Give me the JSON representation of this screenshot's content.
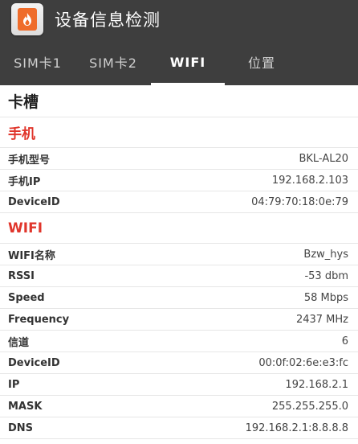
{
  "header": {
    "title": "设备信息检测",
    "icon": "fire-phone-icon"
  },
  "tabs": [
    {
      "label": "SIM卡1",
      "active": false
    },
    {
      "label": "SIM卡2",
      "active": false
    },
    {
      "label": "WIFI",
      "active": true
    },
    {
      "label": "位置",
      "active": false
    }
  ],
  "card": {
    "title": "卡槽"
  },
  "phone_section": {
    "title": "手机",
    "rows": [
      {
        "label": "手机型号",
        "value": "BKL-AL20"
      },
      {
        "label": "手机IP",
        "value": "192.168.2.103"
      },
      {
        "label": "DeviceID",
        "value": "04:79:70:18:0e:79"
      }
    ]
  },
  "wifi_section": {
    "title": "WIFI",
    "rows": [
      {
        "label": "WIFI名称",
        "value": "Bzw_hys"
      },
      {
        "label": "RSSI",
        "value": "-53 dbm"
      },
      {
        "label": "Speed",
        "value": "58 Mbps"
      },
      {
        "label": "Frequency",
        "value": "2437 MHz"
      },
      {
        "label": "信道",
        "value": "6"
      },
      {
        "label": "DeviceID",
        "value": "00:0f:02:6e:e3:fc"
      },
      {
        "label": "IP",
        "value": "192.168.2.1"
      },
      {
        "label": "MASK",
        "value": "255.255.255.0"
      },
      {
        "label": "DNS",
        "value": "192.168.2.1:8.8.8.8"
      }
    ]
  },
  "colors": {
    "appbar": "#3e3e3e",
    "section_red": "#e0352b",
    "icon_orange": "#ef6c2a"
  }
}
